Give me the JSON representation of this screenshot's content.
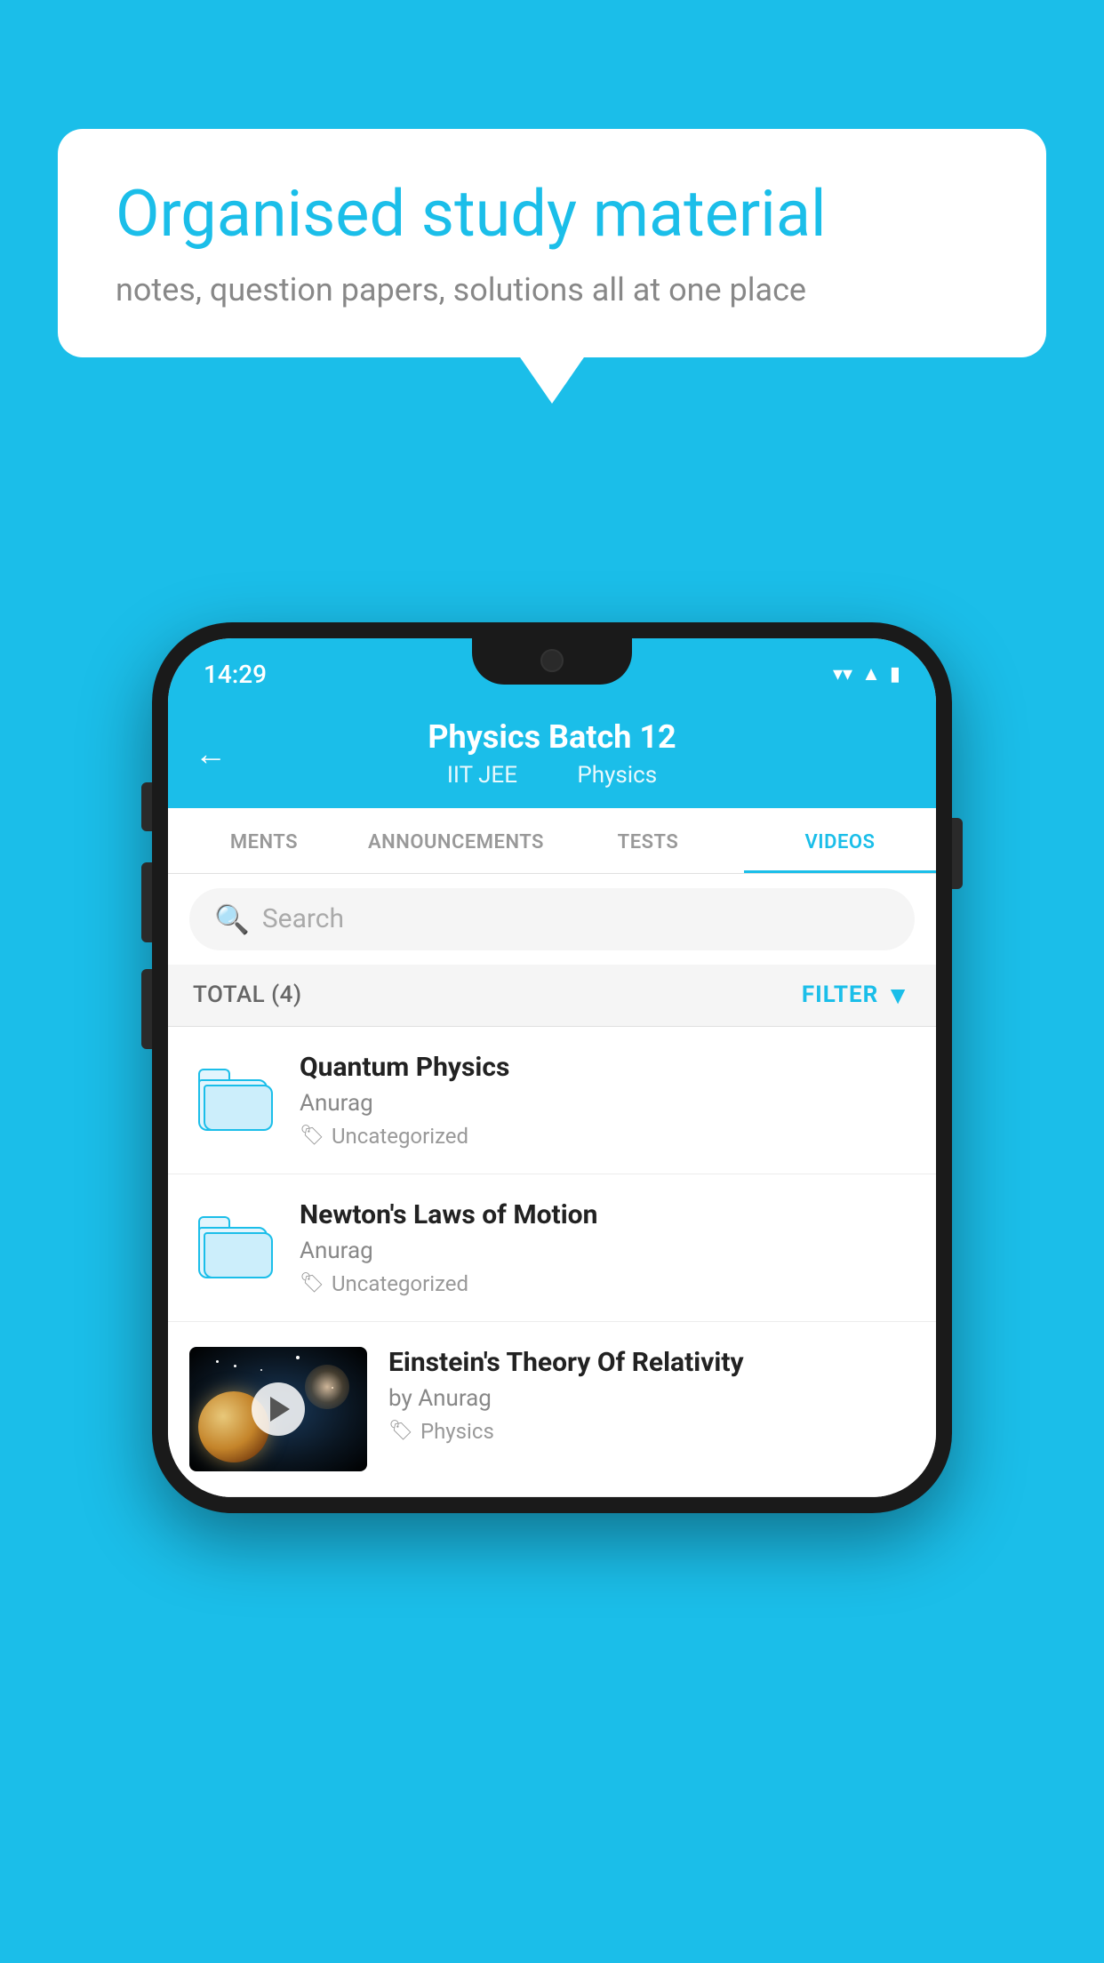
{
  "page": {
    "background_color": "#1BBEE9"
  },
  "speech_bubble": {
    "title": "Organised study material",
    "subtitle": "notes, question papers, solutions all at one place"
  },
  "status_bar": {
    "time": "14:29",
    "icons": [
      "wifi",
      "signal",
      "battery"
    ]
  },
  "app_header": {
    "back_label": "←",
    "title": "Physics Batch 12",
    "subtitle_part1": "IIT JEE",
    "subtitle_part2": "Physics"
  },
  "tabs": [
    {
      "label": "MENTS",
      "active": false
    },
    {
      "label": "ANNOUNCEMENTS",
      "active": false
    },
    {
      "label": "TESTS",
      "active": false
    },
    {
      "label": "VIDEOS",
      "active": true
    }
  ],
  "search": {
    "placeholder": "Search"
  },
  "filter_bar": {
    "total_label": "TOTAL (4)",
    "filter_label": "FILTER"
  },
  "videos": [
    {
      "id": "quantum",
      "title": "Quantum Physics",
      "author": "Anurag",
      "tag": "Uncategorized",
      "type": "folder"
    },
    {
      "id": "newton",
      "title": "Newton's Laws of Motion",
      "author": "Anurag",
      "tag": "Uncategorized",
      "type": "folder"
    },
    {
      "id": "einstein",
      "title": "Einstein's Theory Of Relativity",
      "author": "by Anurag",
      "tag": "Physics",
      "type": "video"
    }
  ]
}
